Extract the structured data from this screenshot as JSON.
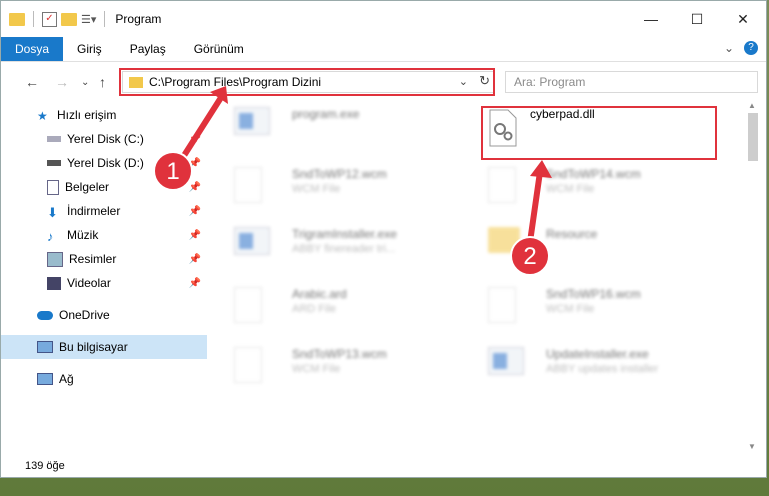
{
  "window": {
    "title": "Program"
  },
  "ribbon": {
    "tabs": [
      "Dosya",
      "Giriş",
      "Paylaş",
      "Görünüm"
    ]
  },
  "address": {
    "path": "C:\\Program Files\\Program Dizini"
  },
  "search": {
    "placeholder": "Ara: Program"
  },
  "sidebar": {
    "items": [
      {
        "label": "Hızlı erişim",
        "icon": "star-icon"
      },
      {
        "label": "Yerel Disk (C:)",
        "icon": "drive-icon",
        "pinned": true
      },
      {
        "label": "Yerel Disk (D:)",
        "icon": "drive-icon",
        "pinned": true
      },
      {
        "label": "Belgeler",
        "icon": "documents-icon",
        "pinned": true
      },
      {
        "label": "İndirmeler",
        "icon": "download-icon",
        "pinned": true
      },
      {
        "label": "Müzik",
        "icon": "music-icon",
        "pinned": true
      },
      {
        "label": "Resimler",
        "icon": "pictures-icon",
        "pinned": true
      },
      {
        "label": "Videolar",
        "icon": "videos-icon",
        "pinned": true
      },
      {
        "label": "OneDrive",
        "icon": "cloud-icon"
      },
      {
        "label": "Bu bilgisayar",
        "icon": "computer-icon",
        "selected": true
      },
      {
        "label": "Ağ",
        "icon": "network-icon"
      }
    ]
  },
  "files": [
    {
      "name": "program.exe",
      "sub": "",
      "blur": true
    },
    {
      "name": "cyberpad.dll",
      "sub": "",
      "blur": false
    },
    {
      "name": "SndToWP12.wcm",
      "sub": "WCM File",
      "blur": true
    },
    {
      "name": "SndToWP14.wcm",
      "sub": "WCM File",
      "blur": true
    },
    {
      "name": "TrigramInstaller.exe",
      "sub": "ABBY finereader tri...",
      "blur": true
    },
    {
      "name": "Resource",
      "sub": "",
      "blur": true
    },
    {
      "name": "Arabic.ard",
      "sub": "ARD File",
      "blur": true
    },
    {
      "name": "SndToWP16.wcm",
      "sub": "WCM File",
      "blur": true
    },
    {
      "name": "SndToWP13.wcm",
      "sub": "WCM File",
      "blur": true
    },
    {
      "name": "UpdateInstaller.exe",
      "sub": "ABBY updates installer",
      "blur": true
    }
  ],
  "status": {
    "count": "139 öğe"
  },
  "annotations": {
    "step1": "1",
    "step2": "2"
  },
  "colors": {
    "accent": "#1979ca",
    "highlight": "#e0323c"
  }
}
